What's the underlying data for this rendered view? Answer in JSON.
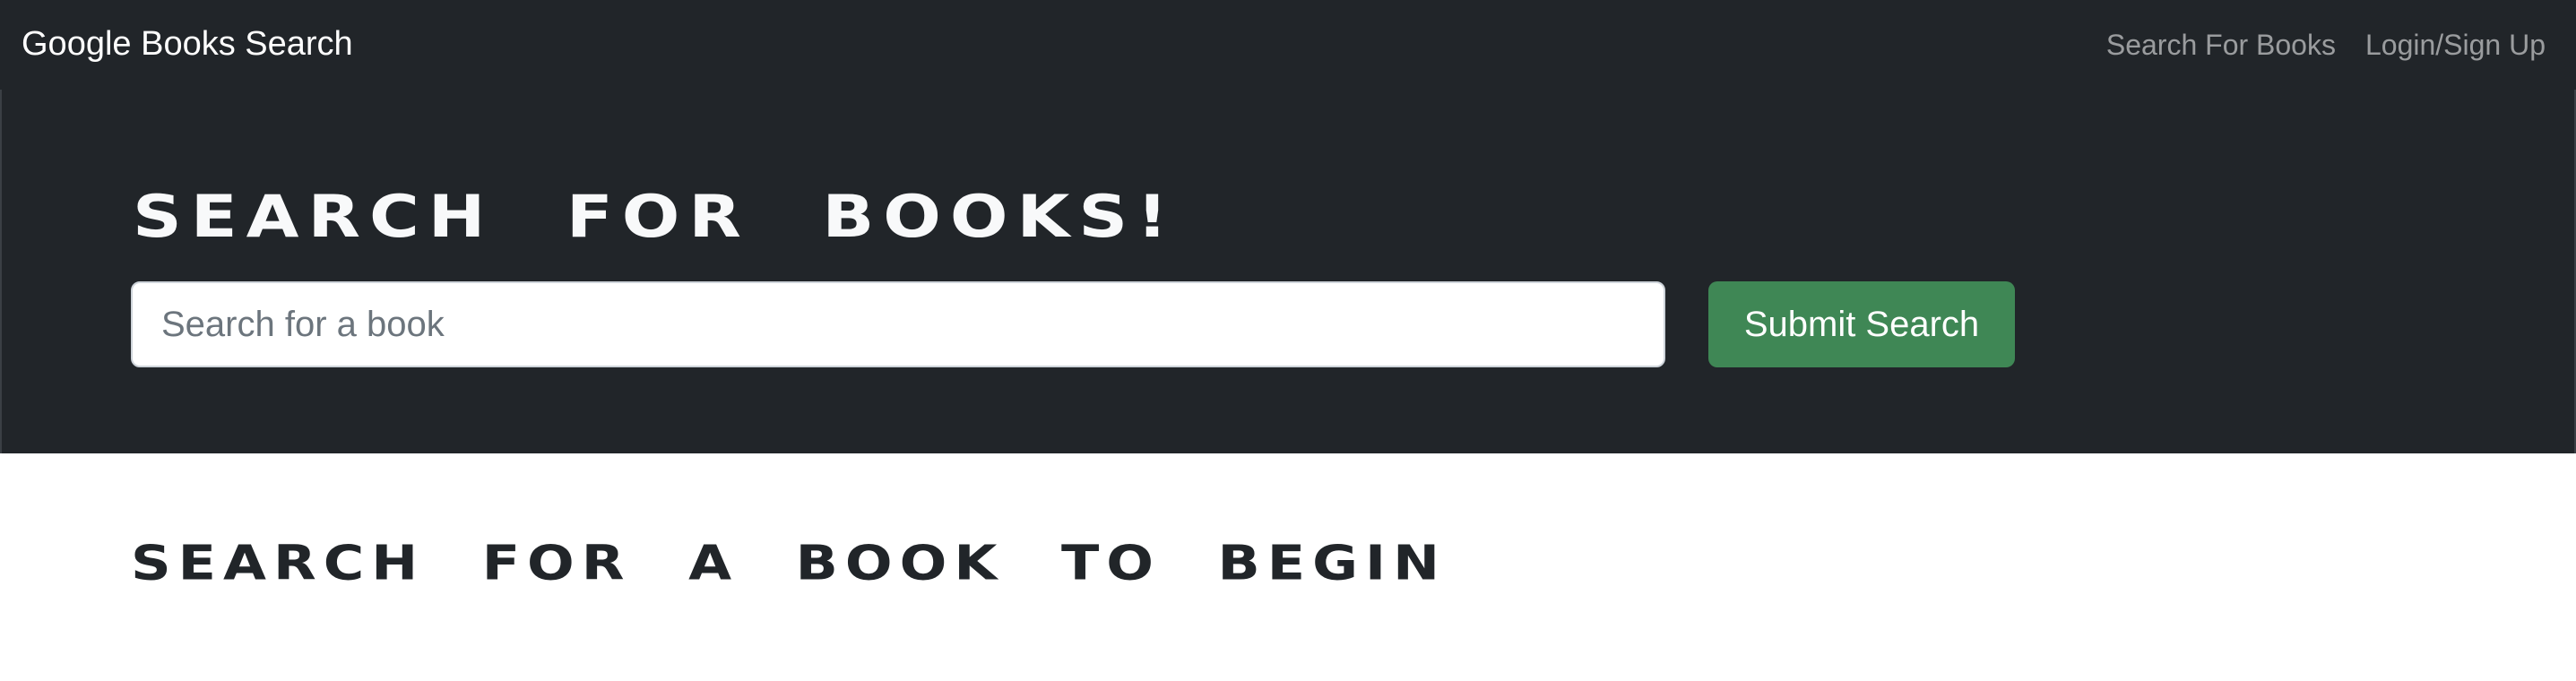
{
  "navbar": {
    "brand": "Google Books Search",
    "links": [
      {
        "label": "Search For Books"
      },
      {
        "label": "Login/Sign Up"
      }
    ]
  },
  "hero": {
    "title": "SEARCH FOR BOOKS!",
    "search": {
      "placeholder": "Search for a book",
      "value": ""
    },
    "submit_label": "Submit Search"
  },
  "results": {
    "heading": "SEARCH FOR A BOOK TO BEGIN"
  },
  "colors": {
    "navbar_bg": "#212529",
    "hero_bg": "#212529",
    "submit_bg": "#3f8755",
    "nav_link": "#8c8f92",
    "heading_text": "#212529"
  }
}
